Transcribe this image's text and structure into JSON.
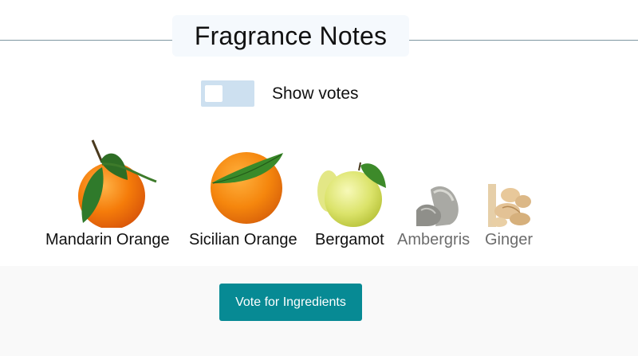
{
  "header": {
    "title": "Fragrance Notes"
  },
  "toggle": {
    "label": "Show votes",
    "on": false
  },
  "notes": [
    {
      "name": "Mandarin Orange",
      "icon": "mandarin-orange-image",
      "faded": false
    },
    {
      "name": "Sicilian Orange",
      "icon": "sicilian-orange-image",
      "faded": false
    },
    {
      "name": "Bergamot",
      "icon": "bergamot-image",
      "faded": false
    },
    {
      "name": "Ambergris",
      "icon": "ambergris-image",
      "faded": true
    },
    {
      "name": "Ginger",
      "icon": "ginger-image",
      "faded": true
    }
  ],
  "actions": {
    "vote_label": "Vote for Ingredients"
  },
  "colors": {
    "accent": "#078a94",
    "toggle_track": "#cde0f0",
    "title_bg": "#f5f9fd",
    "rule": "#7f97a2"
  }
}
